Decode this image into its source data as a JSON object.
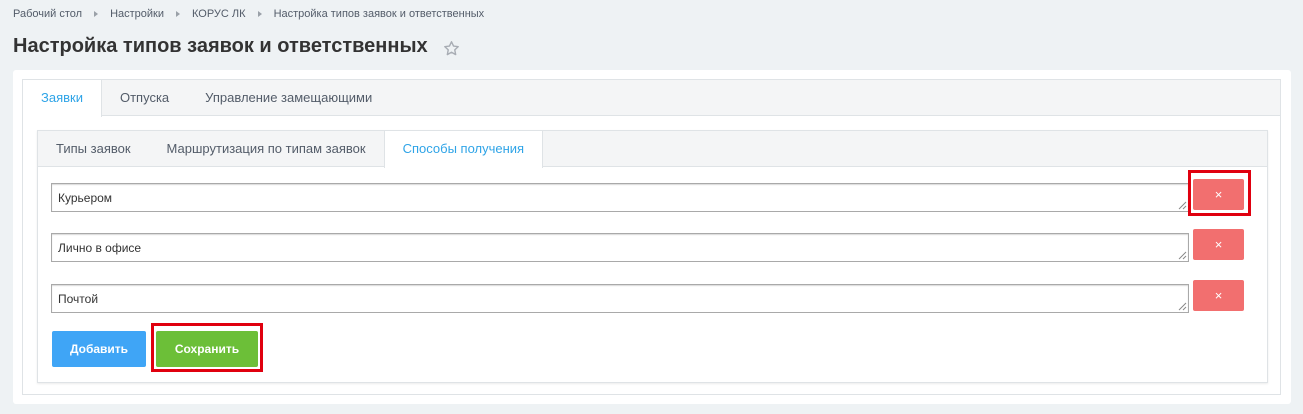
{
  "breadcrumb": {
    "items": [
      "Рабочий стол",
      "Настройки",
      "КОРУС ЛК",
      "Настройка типов заявок и ответственных"
    ]
  },
  "page": {
    "title": "Настройка типов заявок и ответственных"
  },
  "top_tabs": [
    {
      "label": "Заявки",
      "active": true
    },
    {
      "label": "Отпуска",
      "active": false
    },
    {
      "label": "Управление замещающими",
      "active": false
    }
  ],
  "inner_tabs": [
    {
      "label": "Типы заявок",
      "active": false
    },
    {
      "label": "Маршрутизация по типам заявок",
      "active": false
    },
    {
      "label": "Способы получения",
      "active": true
    }
  ],
  "methods": [
    {
      "value": "Курьером",
      "delete_label": "×"
    },
    {
      "value": "Лично в офисе",
      "delete_label": "×"
    },
    {
      "value": "Почтой",
      "delete_label": "×"
    }
  ],
  "actions": {
    "add_label": "Добавить",
    "save_label": "Сохранить"
  },
  "colors": {
    "accent": "#2fa4e7",
    "delete": "#f26f6f",
    "add": "#3fa5f6",
    "save": "#6cbf38",
    "highlight": "#e0000f"
  }
}
